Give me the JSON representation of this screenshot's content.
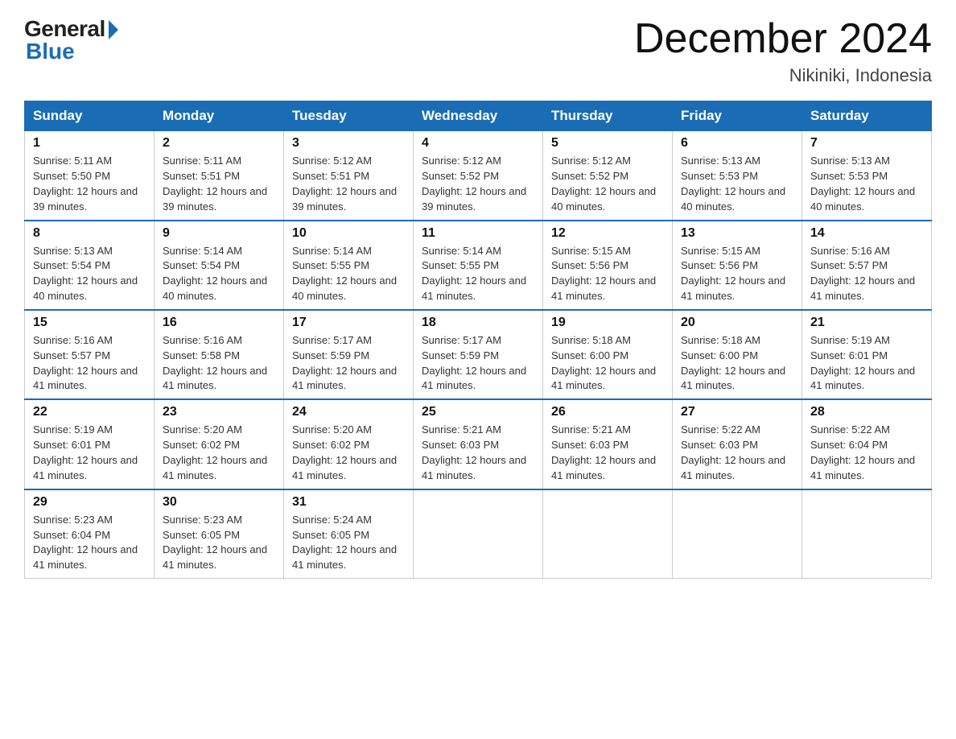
{
  "header": {
    "logo_general": "General",
    "logo_blue": "Blue",
    "title": "December 2024",
    "location": "Nikiniki, Indonesia"
  },
  "weekdays": [
    "Sunday",
    "Monday",
    "Tuesday",
    "Wednesday",
    "Thursday",
    "Friday",
    "Saturday"
  ],
  "weeks": [
    [
      {
        "day": "1",
        "sunrise": "5:11 AM",
        "sunset": "5:50 PM",
        "daylight": "12 hours and 39 minutes."
      },
      {
        "day": "2",
        "sunrise": "5:11 AM",
        "sunset": "5:51 PM",
        "daylight": "12 hours and 39 minutes."
      },
      {
        "day": "3",
        "sunrise": "5:12 AM",
        "sunset": "5:51 PM",
        "daylight": "12 hours and 39 minutes."
      },
      {
        "day": "4",
        "sunrise": "5:12 AM",
        "sunset": "5:52 PM",
        "daylight": "12 hours and 39 minutes."
      },
      {
        "day": "5",
        "sunrise": "5:12 AM",
        "sunset": "5:52 PM",
        "daylight": "12 hours and 40 minutes."
      },
      {
        "day": "6",
        "sunrise": "5:13 AM",
        "sunset": "5:53 PM",
        "daylight": "12 hours and 40 minutes."
      },
      {
        "day": "7",
        "sunrise": "5:13 AM",
        "sunset": "5:53 PM",
        "daylight": "12 hours and 40 minutes."
      }
    ],
    [
      {
        "day": "8",
        "sunrise": "5:13 AM",
        "sunset": "5:54 PM",
        "daylight": "12 hours and 40 minutes."
      },
      {
        "day": "9",
        "sunrise": "5:14 AM",
        "sunset": "5:54 PM",
        "daylight": "12 hours and 40 minutes."
      },
      {
        "day": "10",
        "sunrise": "5:14 AM",
        "sunset": "5:55 PM",
        "daylight": "12 hours and 40 minutes."
      },
      {
        "day": "11",
        "sunrise": "5:14 AM",
        "sunset": "5:55 PM",
        "daylight": "12 hours and 41 minutes."
      },
      {
        "day": "12",
        "sunrise": "5:15 AM",
        "sunset": "5:56 PM",
        "daylight": "12 hours and 41 minutes."
      },
      {
        "day": "13",
        "sunrise": "5:15 AM",
        "sunset": "5:56 PM",
        "daylight": "12 hours and 41 minutes."
      },
      {
        "day": "14",
        "sunrise": "5:16 AM",
        "sunset": "5:57 PM",
        "daylight": "12 hours and 41 minutes."
      }
    ],
    [
      {
        "day": "15",
        "sunrise": "5:16 AM",
        "sunset": "5:57 PM",
        "daylight": "12 hours and 41 minutes."
      },
      {
        "day": "16",
        "sunrise": "5:16 AM",
        "sunset": "5:58 PM",
        "daylight": "12 hours and 41 minutes."
      },
      {
        "day": "17",
        "sunrise": "5:17 AM",
        "sunset": "5:59 PM",
        "daylight": "12 hours and 41 minutes."
      },
      {
        "day": "18",
        "sunrise": "5:17 AM",
        "sunset": "5:59 PM",
        "daylight": "12 hours and 41 minutes."
      },
      {
        "day": "19",
        "sunrise": "5:18 AM",
        "sunset": "6:00 PM",
        "daylight": "12 hours and 41 minutes."
      },
      {
        "day": "20",
        "sunrise": "5:18 AM",
        "sunset": "6:00 PM",
        "daylight": "12 hours and 41 minutes."
      },
      {
        "day": "21",
        "sunrise": "5:19 AM",
        "sunset": "6:01 PM",
        "daylight": "12 hours and 41 minutes."
      }
    ],
    [
      {
        "day": "22",
        "sunrise": "5:19 AM",
        "sunset": "6:01 PM",
        "daylight": "12 hours and 41 minutes."
      },
      {
        "day": "23",
        "sunrise": "5:20 AM",
        "sunset": "6:02 PM",
        "daylight": "12 hours and 41 minutes."
      },
      {
        "day": "24",
        "sunrise": "5:20 AM",
        "sunset": "6:02 PM",
        "daylight": "12 hours and 41 minutes."
      },
      {
        "day": "25",
        "sunrise": "5:21 AM",
        "sunset": "6:03 PM",
        "daylight": "12 hours and 41 minutes."
      },
      {
        "day": "26",
        "sunrise": "5:21 AM",
        "sunset": "6:03 PM",
        "daylight": "12 hours and 41 minutes."
      },
      {
        "day": "27",
        "sunrise": "5:22 AM",
        "sunset": "6:03 PM",
        "daylight": "12 hours and 41 minutes."
      },
      {
        "day": "28",
        "sunrise": "5:22 AM",
        "sunset": "6:04 PM",
        "daylight": "12 hours and 41 minutes."
      }
    ],
    [
      {
        "day": "29",
        "sunrise": "5:23 AM",
        "sunset": "6:04 PM",
        "daylight": "12 hours and 41 minutes."
      },
      {
        "day": "30",
        "sunrise": "5:23 AM",
        "sunset": "6:05 PM",
        "daylight": "12 hours and 41 minutes."
      },
      {
        "day": "31",
        "sunrise": "5:24 AM",
        "sunset": "6:05 PM",
        "daylight": "12 hours and 41 minutes."
      },
      null,
      null,
      null,
      null
    ]
  ]
}
